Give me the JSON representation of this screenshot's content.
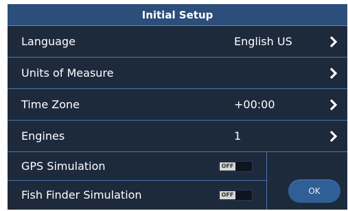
{
  "dialog": {
    "title": "Initial Setup",
    "rows": [
      {
        "label": "Language",
        "value": "English US",
        "icon": "chevron-right-icon"
      },
      {
        "label": "Units of Measure",
        "value": "",
        "icon": "chevron-right-icon"
      },
      {
        "label": "Time Zone",
        "value": "+00:00",
        "icon": "chevron-right-icon"
      },
      {
        "label": "Engines",
        "value": "1",
        "icon": "chevron-right-icon"
      }
    ],
    "toggles": [
      {
        "label": "GPS Simulation",
        "state": "OFF"
      },
      {
        "label": "Fish Finder Simulation",
        "state": "OFF"
      }
    ],
    "ok_label": "OK"
  },
  "colors": {
    "background": "#1d2a3c",
    "title_bar": "#2c4e7a",
    "divider": "#4a76a8",
    "ok_button": "#2f5f96"
  }
}
